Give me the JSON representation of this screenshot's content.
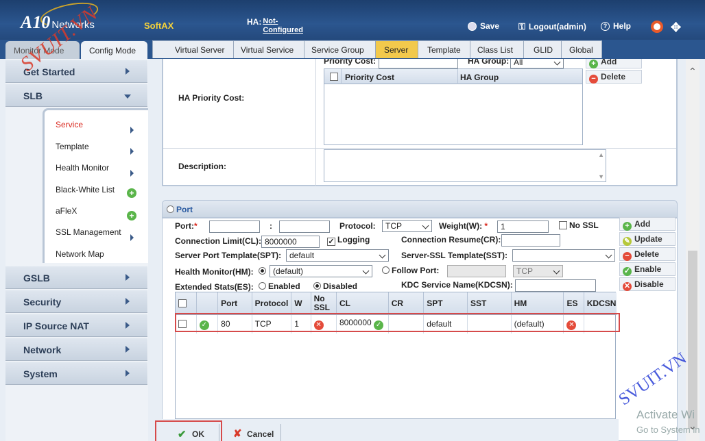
{
  "header": {
    "logo_main": "A10",
    "logo_sub": "Networks",
    "product": "SoftAX",
    "ha_label": "HA:",
    "ha_value": "Not-Configured",
    "save": "Save",
    "logout": "Logout(admin)",
    "help": "Help"
  },
  "modes": {
    "monitor": "Monitor Mode",
    "config": "Config Mode"
  },
  "sidebar": {
    "get_started": "Get Started",
    "slb": "SLB",
    "sub": [
      "Service",
      "Template",
      "Health Monitor",
      "Black-White List",
      "aFleX",
      "SSL Management",
      "Network Map"
    ],
    "gslb": "GSLB",
    "security": "Security",
    "ip_source_nat": "IP Source NAT",
    "network": "Network",
    "system": "System"
  },
  "tabs": [
    "Virtual Server",
    "Virtual Service",
    "Service Group",
    "Server",
    "Template",
    "Class List",
    "GLID",
    "Global"
  ],
  "ha_priority": {
    "label": "HA Priority Cost:",
    "priority_cost_label": "Priority Cost:",
    "ha_group_label": "HA Group:",
    "ha_group_value": "All",
    "col_priority": "Priority Cost",
    "col_ha_group": "HA Group",
    "add": "Add",
    "delete": "Delete"
  },
  "description": {
    "label": "Description:"
  },
  "port": {
    "section_title": "Port",
    "port_label": "Port:",
    "required": "*",
    "colon": ":",
    "protocol_label": "Protocol:",
    "protocol_value": "TCP",
    "weight_label": "Weight(W):",
    "weight_value": "1",
    "no_ssl": "No SSL",
    "conn_limit_label": "Connection Limit(CL):",
    "conn_limit_value": "8000000",
    "logging": "Logging",
    "conn_resume_label": "Connection Resume(CR):",
    "spt_label": "Server Port Template(SPT):",
    "spt_value": "default",
    "sst_label": "Server-SSL Template(SST):",
    "hm_label": "Health Monitor(HM):",
    "hm_value": "(default)",
    "follow_port": "Follow Port:",
    "follow_proto": "TCP",
    "es_label": "Extended Stats(ES):",
    "enabled": "Enabled",
    "disabled": "Disabled",
    "kdc_label": "KDC Service Name(KDCSN):",
    "buttons": {
      "add": "Add",
      "update": "Update",
      "delete": "Delete",
      "enable": "Enable",
      "disable": "Disable"
    }
  },
  "grid": {
    "headers": [
      "",
      "",
      "Port",
      "Protocol",
      "W",
      "No SSL",
      "CL",
      "CR",
      "SPT",
      "SST",
      "HM",
      "ES",
      "KDCSN"
    ],
    "row": {
      "port": "80",
      "protocol": "TCP",
      "w": "1",
      "cl": "8000000",
      "spt": "default",
      "hm": "(default)"
    }
  },
  "footer": {
    "ok": "OK",
    "cancel": "Cancel"
  },
  "watermark": {
    "top": "SVUIT.VN",
    "bottom": "SVUIT.VN"
  },
  "activate": {
    "line1": "Activate Wi",
    "line2": "Go to System in"
  }
}
